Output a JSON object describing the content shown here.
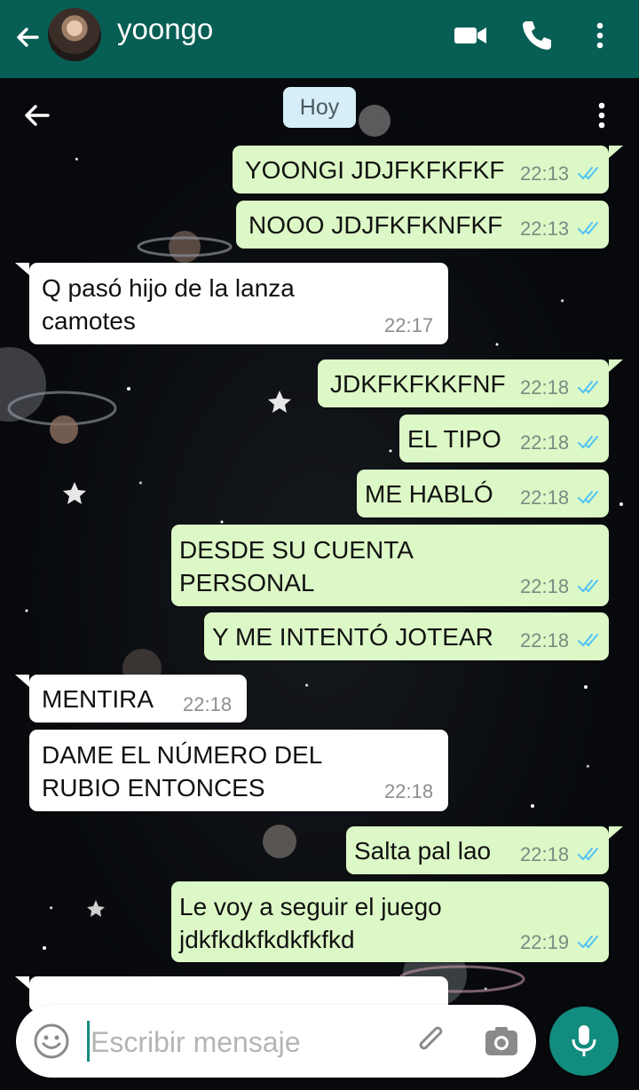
{
  "header": {
    "contact_name": "yoongo"
  },
  "date_chip": "Hoy",
  "messages": [
    {
      "dir": "out",
      "text": "YOONGI JDJFKFKFKF",
      "time": "22:13",
      "status": "read"
    },
    {
      "dir": "out",
      "text": "NOOO JDJFKFKNFKF",
      "time": "22:13",
      "status": "read"
    },
    {
      "dir": "in",
      "text": "Q pasó hijo de la lanza\ncamotes",
      "time": "22:17"
    },
    {
      "dir": "out",
      "text": "JDKFKFKKFNF",
      "time": "22:18",
      "status": "read"
    },
    {
      "dir": "out",
      "text": "EL TIPO",
      "time": "22:18",
      "status": "read"
    },
    {
      "dir": "out",
      "text": "ME HABLÓ",
      "time": "22:18",
      "status": "read"
    },
    {
      "dir": "out",
      "text": "DESDE SU CUENTA\nPERSONAL",
      "time": "22:18",
      "status": "read"
    },
    {
      "dir": "out",
      "text": "Y ME INTENTÓ JOTEAR",
      "time": "22:18",
      "status": "read"
    },
    {
      "dir": "in",
      "text": "MENTIRA",
      "time": "22:18"
    },
    {
      "dir": "in",
      "text": "DAME EL NÚMERO DEL\nRUBIO ENTONCES",
      "time": "22:18"
    },
    {
      "dir": "out",
      "text": "Salta pal lao",
      "time": "22:18",
      "status": "read"
    },
    {
      "dir": "out",
      "text": "Le voy a seguir el juego\njdkfkdkfkdkfkfkd",
      "time": "22:19",
      "status": "read"
    }
  ],
  "composer": {
    "placeholder": "Escribir mensaje"
  },
  "colors": {
    "header": "#075e54",
    "outgoing_bubble": "#dcf8c6",
    "incoming_bubble": "#ffffff",
    "read_ticks": "#4fc3f7",
    "mic_button": "#128c7e"
  },
  "icons": [
    "back-arrow-icon",
    "video-call-icon",
    "phone-icon",
    "more-vert-icon",
    "emoji-icon",
    "paperclip-icon",
    "camera-icon",
    "mic-icon"
  ]
}
